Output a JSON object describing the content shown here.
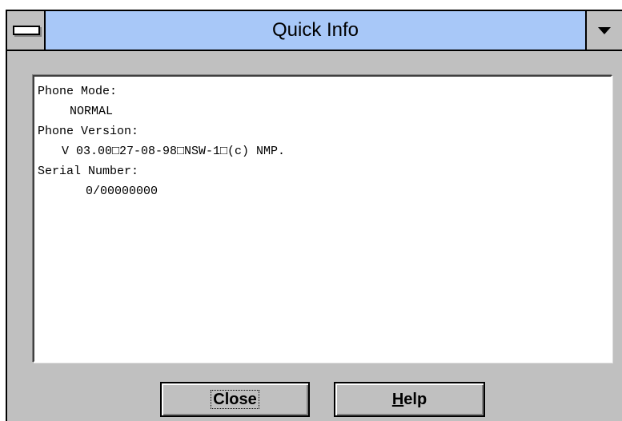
{
  "window": {
    "title": "Quick Info"
  },
  "info": {
    "phone_mode_label": "Phone Mode:",
    "phone_mode_value": "NORMAL",
    "phone_version_label": "Phone Version:",
    "phone_version_value": "V 03.00□27-08-98□NSW-1□(c) NMP.",
    "serial_number_label": "Serial Number:",
    "serial_number_value": "0/00000000"
  },
  "buttons": {
    "close_label": "Close",
    "help_label_mnemonic": "H",
    "help_label_rest": "elp"
  },
  "icons": {
    "system_menu": "system-menu-icon",
    "dropdown": "chevron-down-icon"
  },
  "colors": {
    "title_bar": "#a8c8f8",
    "window_face": "#c0c0c0",
    "text_area": "#ffffff"
  }
}
